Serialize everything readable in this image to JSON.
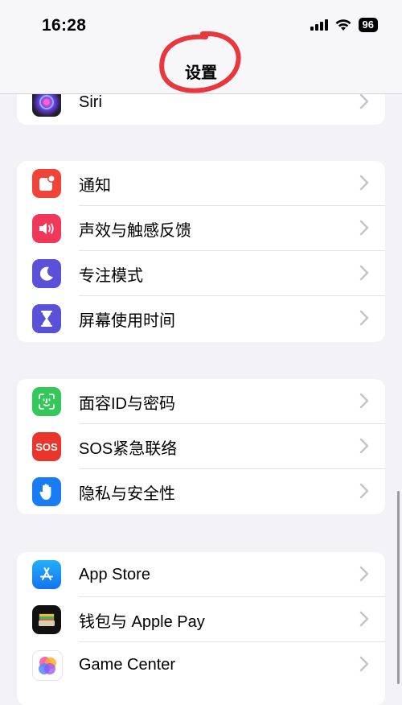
{
  "status_bar": {
    "time": "16:28",
    "battery": "96"
  },
  "nav": {
    "title": "设置"
  },
  "groups": [
    {
      "items": [
        {
          "label": "Siri",
          "icon": "siri-icon"
        }
      ]
    },
    {
      "items": [
        {
          "label": "通知",
          "icon": "notifications-icon",
          "color": "#f04438"
        },
        {
          "label": "声效与触感反馈",
          "icon": "sound-icon",
          "color": "#f0385a"
        },
        {
          "label": "专注模式",
          "icon": "moon-icon",
          "color": "#5b51d8"
        },
        {
          "label": "屏幕使用时间",
          "icon": "hourglass-icon",
          "color": "#5b51d8"
        }
      ]
    },
    {
      "items": [
        {
          "label": "面容ID与密码",
          "icon": "face-id-icon",
          "color": "#34c759"
        },
        {
          "label": "SOS紧急联络",
          "icon": "sos-icon",
          "color": "#e8362d",
          "icon_text": "SOS"
        },
        {
          "label": "隐私与安全性",
          "icon": "hand-icon",
          "color": "#1a7cf5"
        }
      ]
    },
    {
      "items": [
        {
          "label": "App Store",
          "icon": "app-store-icon",
          "color": "#1c8af5"
        },
        {
          "label": "钱包与 Apple Pay",
          "icon": "wallet-icon",
          "color": "#111111"
        },
        {
          "label": "Game Center",
          "icon": "game-center-icon",
          "color": "#ffffff"
        }
      ]
    }
  ]
}
